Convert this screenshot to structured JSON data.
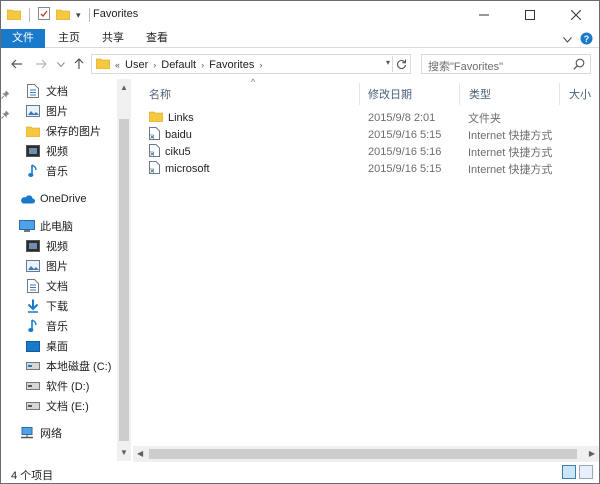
{
  "window": {
    "title": "Favorites"
  },
  "window_controls": {
    "minimize": "—",
    "maximize": "☐",
    "close": "✕"
  },
  "ribbon": {
    "tabs": [
      {
        "label": "文件",
        "active": true
      },
      {
        "label": "主页"
      },
      {
        "label": "共享"
      },
      {
        "label": "查看"
      }
    ]
  },
  "address": {
    "overflow": "«",
    "crumbs": [
      "User",
      "Default",
      "Favorites"
    ]
  },
  "search": {
    "placeholder": "搜索\"Favorites\""
  },
  "nav": {
    "quick_access": [
      {
        "label": "文档",
        "icon": "document-icon",
        "pinned": true
      },
      {
        "label": "图片",
        "icon": "picture-icon",
        "pinned": true
      },
      {
        "label": "保存的图片",
        "icon": "folder-icon"
      },
      {
        "label": "视频",
        "icon": "video-icon"
      },
      {
        "label": "音乐",
        "icon": "music-icon"
      }
    ],
    "onedrive": {
      "label": "OneDrive",
      "icon": "cloud-icon"
    },
    "this_pc": {
      "label": "此电脑",
      "icon": "computer-icon"
    },
    "this_pc_items": [
      {
        "label": "视频",
        "icon": "video-icon"
      },
      {
        "label": "图片",
        "icon": "picture-icon"
      },
      {
        "label": "文档",
        "icon": "document-icon"
      },
      {
        "label": "下载",
        "icon": "download-icon"
      },
      {
        "label": "音乐",
        "icon": "music-icon"
      },
      {
        "label": "桌面",
        "icon": "desktop-icon"
      },
      {
        "label": "本地磁盘 (C:)",
        "icon": "drive-icon"
      },
      {
        "label": "软件 (D:)",
        "icon": "drive-icon"
      },
      {
        "label": "文档 (E:)",
        "icon": "drive-icon"
      }
    ],
    "network": {
      "label": "网络",
      "icon": "network-icon"
    }
  },
  "columns": {
    "name": "名称",
    "date": "修改日期",
    "type": "类型",
    "size": "大小"
  },
  "files": [
    {
      "name": "Links",
      "date": "2015/9/8 2:01",
      "type": "文件夹",
      "icon": "folder-icon"
    },
    {
      "name": "baidu",
      "date": "2015/9/16 5:15",
      "type": "Internet 快捷方式",
      "icon": "shortcut-icon"
    },
    {
      "name": "ciku5",
      "date": "2015/9/16 5:16",
      "type": "Internet 快捷方式",
      "icon": "shortcut-icon"
    },
    {
      "name": "microsoft",
      "date": "2015/9/16 5:15",
      "type": "Internet 快捷方式",
      "icon": "shortcut-icon"
    }
  ],
  "status": {
    "count": "4 个项目"
  },
  "colors": {
    "accent": "#1979ca",
    "folder": "#f5c842",
    "header_text": "#4c607a"
  }
}
